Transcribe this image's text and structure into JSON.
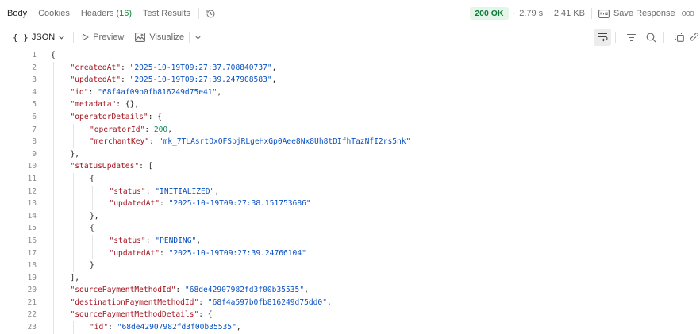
{
  "tabs": [
    {
      "label": "Body",
      "active": true
    },
    {
      "label": "Cookies"
    },
    {
      "label": "Headers",
      "count": "(16)"
    },
    {
      "label": "Test Results"
    }
  ],
  "status": {
    "code": "200 OK",
    "time": "2.79 s",
    "size": "2.41 KB",
    "save_label": "Save Response",
    "more": "ooo"
  },
  "toolbar": {
    "format_icon": "{ }",
    "format": "JSON",
    "preview": "Preview",
    "visualize": "Visualize"
  },
  "icons": {
    "history": "history-icon",
    "save": "save-response-icon",
    "wrap": "wrap-lines-icon",
    "filter": "filter-icon",
    "search": "search-icon",
    "copy": "copy-icon",
    "link": "link-icon"
  },
  "colors": {
    "key": "#a3141e",
    "string": "#0b51c1",
    "number": "#098658",
    "status_bg": "#e3f6e9",
    "status_fg": "#0f7a37",
    "headers_count": "#0f8a3c"
  },
  "code": {
    "lines": [
      [
        {
          "t": "p",
          "v": "{"
        }
      ],
      [
        {
          "t": "k",
          "v": "\"createdAt\""
        },
        {
          "t": "p",
          "v": ": "
        },
        {
          "t": "s",
          "v": "\"2025-10-19T09:27:37.708840737\""
        },
        {
          "t": "p",
          "v": ","
        }
      ],
      [
        {
          "t": "k",
          "v": "\"updatedAt\""
        },
        {
          "t": "p",
          "v": ": "
        },
        {
          "t": "s",
          "v": "\"2025-10-19T09:27:39.247908583\""
        },
        {
          "t": "p",
          "v": ","
        }
      ],
      [
        {
          "t": "k",
          "v": "\"id\""
        },
        {
          "t": "p",
          "v": ": "
        },
        {
          "t": "s",
          "v": "\"68f4af09b0fb816249d75e41\""
        },
        {
          "t": "p",
          "v": ","
        }
      ],
      [
        {
          "t": "k",
          "v": "\"metadata\""
        },
        {
          "t": "p",
          "v": ": {},"
        }
      ],
      [
        {
          "t": "k",
          "v": "\"operatorDetails\""
        },
        {
          "t": "p",
          "v": ": {"
        }
      ],
      [
        {
          "t": "k",
          "v": "\"operatorId\""
        },
        {
          "t": "p",
          "v": ": "
        },
        {
          "t": "n",
          "v": "200"
        },
        {
          "t": "p",
          "v": ","
        }
      ],
      [
        {
          "t": "k",
          "v": "\"merchantKey\""
        },
        {
          "t": "p",
          "v": ": "
        },
        {
          "t": "s",
          "v": "\"mk_7TLAsrtOxQFSpjRLgeHxGp0Aee8Nx8Uh8tDIfhTazNfI2rs5nk\""
        }
      ],
      [
        {
          "t": "p",
          "v": "},"
        }
      ],
      [
        {
          "t": "k",
          "v": "\"statusUpdates\""
        },
        {
          "t": "p",
          "v": ": ["
        }
      ],
      [
        {
          "t": "p",
          "v": "{"
        }
      ],
      [
        {
          "t": "k",
          "v": "\"status\""
        },
        {
          "t": "p",
          "v": ": "
        },
        {
          "t": "s",
          "v": "\"INITIALIZED\""
        },
        {
          "t": "p",
          "v": ","
        }
      ],
      [
        {
          "t": "k",
          "v": "\"updatedAt\""
        },
        {
          "t": "p",
          "v": ": "
        },
        {
          "t": "s",
          "v": "\"2025-10-19T09:27:38.151753686\""
        }
      ],
      [
        {
          "t": "p",
          "v": "},"
        }
      ],
      [
        {
          "t": "p",
          "v": "{"
        }
      ],
      [
        {
          "t": "k",
          "v": "\"status\""
        },
        {
          "t": "p",
          "v": ": "
        },
        {
          "t": "s",
          "v": "\"PENDING\""
        },
        {
          "t": "p",
          "v": ","
        }
      ],
      [
        {
          "t": "k",
          "v": "\"updatedAt\""
        },
        {
          "t": "p",
          "v": ": "
        },
        {
          "t": "s",
          "v": "\"2025-10-19T09:27:39.24766104\""
        }
      ],
      [
        {
          "t": "p",
          "v": "}"
        }
      ],
      [
        {
          "t": "p",
          "v": "],"
        }
      ],
      [
        {
          "t": "k",
          "v": "\"sourcePaymentMethodId\""
        },
        {
          "t": "p",
          "v": ": "
        },
        {
          "t": "s",
          "v": "\"68de42907982fd3f00b35535\""
        },
        {
          "t": "p",
          "v": ","
        }
      ],
      [
        {
          "t": "k",
          "v": "\"destinationPaymentMethodId\""
        },
        {
          "t": "p",
          "v": ": "
        },
        {
          "t": "s",
          "v": "\"68f4a597b0fb816249d75dd0\""
        },
        {
          "t": "p",
          "v": ","
        }
      ],
      [
        {
          "t": "k",
          "v": "\"sourcePaymentMethodDetails\""
        },
        {
          "t": "p",
          "v": ": {"
        }
      ],
      [
        {
          "t": "k",
          "v": "\"id\""
        },
        {
          "t": "p",
          "v": ": "
        },
        {
          "t": "s",
          "v": "\"68de42907982fd3f00b35535\""
        },
        {
          "t": "p",
          "v": ","
        }
      ]
    ]
  }
}
